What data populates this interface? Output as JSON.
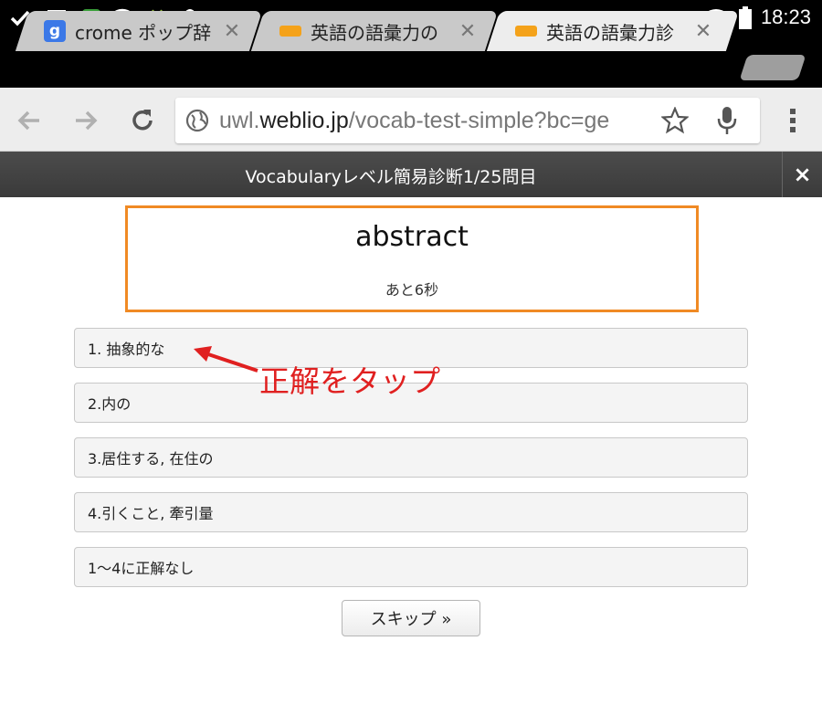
{
  "status_bar": {
    "time": "18:23",
    "left_icons": [
      "check-icon",
      "gallery-icon",
      "evernote-icon",
      "wifi-signal-icon",
      "android-debug-icon",
      "store-bag-icon"
    ],
    "right_icons": [
      "wifi-icon",
      "battery-icon"
    ]
  },
  "tabs": [
    {
      "label": "crome ポップ辞",
      "favicon_text": "g",
      "favicon_color": "#3b78e7",
      "active": false
    },
    {
      "label": "英語の語彙力の",
      "favicon_text": "",
      "favicon_color": "#f4a21a",
      "active": false
    },
    {
      "label": "英語の語彙力診",
      "favicon_text": "",
      "favicon_color": "#f4a21a",
      "active": true
    }
  ],
  "toolbar": {
    "url_prefix": "uwl.",
    "url_host": "weblio.jp",
    "url_path": "/vocab-test-simple?bc=ge"
  },
  "overlay": {
    "title": "Vocabularyレベル簡易診断1/25問目",
    "close_label": "×"
  },
  "quiz": {
    "word": "abstract",
    "timer": "あと6秒",
    "choices": [
      "1. 抽象的な",
      "2.内の",
      "3.居住する, 在住の",
      "4.引くこと, 牽引量",
      "1〜4に正解なし"
    ],
    "skip_label": "スキップ »"
  },
  "annotation": {
    "text": "正解をタップ",
    "color": "#e02020"
  },
  "colors": {
    "accent_border": "#f08a24",
    "header_bg": "#444444"
  }
}
